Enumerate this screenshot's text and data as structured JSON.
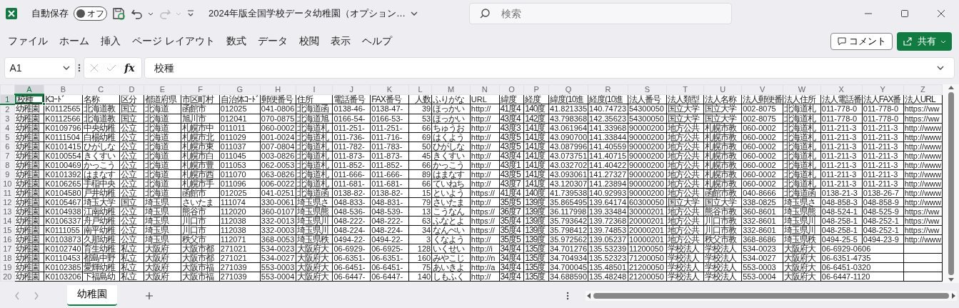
{
  "title_bar": {
    "autosave_label": "自動保存",
    "autosave": {
      "on": false,
      "label": "オフ"
    },
    "redo_disabled": true,
    "document_title": "2024年版全国学校データ幼稚園（オプション…",
    "search": {
      "placeholder": "検索"
    }
  },
  "menu": [
    "ファイル",
    "ホーム",
    "挿入",
    "ページ レイアウト",
    "数式",
    "データ",
    "校閲",
    "表示",
    "ヘルプ"
  ],
  "actions": [
    {
      "label": "コメント",
      "kind": "outline"
    },
    {
      "label": "共有",
      "kind": "primary"
    }
  ],
  "formula_bar": {
    "name_box": "A1",
    "function_label": "fx",
    "formula": "校種"
  },
  "sheet": {
    "columns": [
      {
        "letter": "A",
        "selected": true
      },
      {
        "letter": "B",
        "selected": false
      },
      {
        "letter": "C",
        "selected": false
      },
      {
        "letter": "D",
        "selected": false
      },
      {
        "letter": "E",
        "selected": false
      },
      {
        "letter": "F",
        "selected": false
      },
      {
        "letter": "G",
        "selected": false
      },
      {
        "letter": "H",
        "selected": false
      },
      {
        "letter": "I",
        "selected": false
      },
      {
        "letter": "J",
        "selected": false
      },
      {
        "letter": "K",
        "selected": false
      },
      {
        "letter": "L",
        "selected": false,
        "numeric": true
      },
      {
        "letter": "M",
        "selected": false
      },
      {
        "letter": "N",
        "selected": false
      },
      {
        "letter": "O",
        "selected": false
      },
      {
        "letter": "P",
        "selected": false
      },
      {
        "letter": "Q",
        "selected": false
      },
      {
        "letter": "R",
        "selected": false
      },
      {
        "letter": "S",
        "selected": false
      },
      {
        "letter": "T",
        "selected": false
      },
      {
        "letter": "U",
        "selected": false
      },
      {
        "letter": "V",
        "selected": false
      },
      {
        "letter": "W",
        "selected": false
      },
      {
        "letter": "X",
        "selected": false
      },
      {
        "letter": "Y",
        "selected": false
      },
      {
        "letter": "Z",
        "selected": false
      }
    ],
    "rows": [
      {
        "number": "1",
        "selected": true,
        "cells": [
          "校種",
          "Kｺｰﾄﾞ",
          "名称",
          "区分",
          "都道府県",
          "市区町村",
          "自治体ｺｰﾄﾞ",
          "郵便番号",
          "住所",
          "電話番号",
          "FAX番号",
          "人数",
          "ふりがな",
          "URL",
          "緯度",
          "経度",
          "緯度(10進",
          "経度(10進",
          "法人番号",
          "法人類型",
          "法人名称",
          "法人郵便番",
          "法人住所",
          "法人電話番",
          "法人FAX番",
          "法人URL"
        ]
      },
      {
        "number": "2",
        "selected": false,
        "cells": [
          "幼稚園",
          "K0112565",
          "北海道教",
          "国立",
          "北海道",
          "函館市",
          "012025",
          "041-0806",
          "北海道函",
          "0138-46-",
          "0138-47-",
          "39",
          "ほっかい",
          "http://",
          "41度4",
          "140度",
          "41.821335",
          "140.74723",
          "54300050",
          "国立大学",
          "国立大学",
          "002-8075",
          "北海道札",
          "011-778-0",
          "011-778-0",
          "https://ww"
        ]
      },
      {
        "number": "3",
        "selected": false,
        "cells": [
          "幼稚園",
          "K0112566",
          "北海道教",
          "国立",
          "北海道",
          "旭川市",
          "012041",
          "070-0875",
          "北海道旭",
          "0166-54-",
          "0166-53-",
          "53",
          "ほっかい",
          "http://",
          "43度4",
          "142度",
          "43.798368",
          "142.35623",
          "54300050",
          "国立大学",
          "国立大学",
          "002-8075",
          "北海道札",
          "011-778-0",
          "011-778-0",
          "https://ww"
        ]
      },
      {
        "number": "4",
        "selected": false,
        "cells": [
          "幼稚園",
          "K0109796",
          "中央幼稚",
          "公立",
          "北海道",
          "札幌市中",
          "011011",
          "060-0002",
          "北海道札",
          "011-251-",
          "011-251-",
          "66",
          "ちゅうお",
          "http://",
          "43度3",
          "141度",
          "43.061964",
          "141.33968",
          "90000200",
          "地方公共",
          "札幌市教",
          "060-0002",
          "北海道札",
          "011-211-3",
          "011-211-3",
          "http://www"
        ]
      },
      {
        "number": "5",
        "selected": false,
        "cells": [
          "幼稚園",
          "K0111504",
          "白楊幼稚",
          "公立",
          "北海道",
          "札幌市北",
          "011029",
          "001-0024",
          "北海道札",
          "011-736-",
          "011-716-",
          "69",
          "はくよう",
          "http://",
          "43度5",
          "141度",
          "43.090700",
          "141.33844",
          "90000200",
          "地方公共",
          "札幌市教",
          "060-0002",
          "北海道札",
          "011-211-3",
          "011-211-3",
          "http://www"
        ]
      },
      {
        "number": "6",
        "selected": false,
        "cells": [
          "幼稚園",
          "K0101415",
          "ひがしな",
          "公立",
          "北海道",
          "札幌市東",
          "011037",
          "007-0804",
          "北海道札",
          "011-782-",
          "011-783-",
          "50",
          "ひがしな",
          "http://",
          "43度5",
          "141度",
          "43.087996",
          "141.40559",
          "90000200",
          "地方公共",
          "札幌市教",
          "060-0002",
          "北海道札",
          "011-211-3",
          "011-211-3",
          "http://www"
        ]
      },
      {
        "number": "7",
        "selected": false,
        "cells": [
          "幼稚園",
          "K0100554",
          "きくすい",
          "公立",
          "北海道",
          "札幌市白",
          "011045",
          "003-0826",
          "北海道札",
          "011-873-",
          "011-873-",
          "45",
          "きくすい",
          "http://",
          "43度4",
          "141度",
          "43.073751",
          "141.40715",
          "90000200",
          "地方公共",
          "札幌市教",
          "060-0002",
          "北海道札",
          "011-211-3",
          "011-211-3",
          "http://www"
        ]
      },
      {
        "number": "8",
        "selected": false,
        "cells": [
          "幼稚園",
          "K0100469",
          "かっこう",
          "公立",
          "北海道",
          "札幌市豊",
          "011053",
          "062-0053",
          "北海道札",
          "011-852-",
          "011-852-",
          "66",
          "かっこう",
          "http://",
          "43度1",
          "141度",
          "43.032702",
          "141.40422",
          "90000200",
          "地方公共",
          "札幌市教",
          "060-0002",
          "北海道札",
          "011-211-3",
          "011-211-3",
          "http://www"
        ]
      },
      {
        "number": "9",
        "selected": false,
        "cells": [
          "幼稚園",
          "K0101392",
          "はまなす",
          "公立",
          "北海道",
          "札幌市西",
          "011070",
          "063-0826",
          "北海道札",
          "011-666-",
          "011-666-",
          "89",
          "はまなす",
          "http://",
          "43度5",
          "141度",
          "43.093061",
          "141.27327",
          "90000200",
          "地方公共",
          "札幌市教",
          "060-0002",
          "北海道札",
          "011-211-3",
          "011-211-3",
          "http://www"
        ]
      },
      {
        "number": "10",
        "selected": false,
        "cells": [
          "幼稚園",
          "K0106265",
          "手稲中央",
          "公立",
          "北海道",
          "札幌市手",
          "011096",
          "006-0022",
          "北海道札",
          "011-681-",
          "011-681-",
          "66",
          "ていねち",
          "http://",
          "43度7",
          "141度",
          "43.120307",
          "141.23894",
          "90000200",
          "地方公共",
          "札幌市教",
          "060-0002",
          "北海道札",
          "011-211-3",
          "011-211-3",
          "http://www"
        ]
      },
      {
        "number": "11",
        "selected": false,
        "cells": [
          "幼稚園",
          "K0104580",
          "戸井幼稚",
          "公立",
          "北海道",
          "函館市",
          "012025",
          "041-0251",
          "北海道函",
          "0138-82-",
          "0138-82-",
          "15",
          "といよう",
          "https://",
          "41度4",
          "140度",
          "41.739538",
          "140.92993",
          "90000200",
          "地方公共",
          "函館市教",
          "040-8666",
          "北海道函",
          "0138-21-3",
          "0138-26-7",
          "http://www"
        ]
      },
      {
        "number": "12",
        "selected": false,
        "cells": [
          "幼稚園",
          "K0105467",
          "埼玉大学",
          "国立",
          "埼玉県",
          "さいたま",
          "111074",
          "330-0061",
          "埼玉県さ",
          "048-833-",
          "048-831-",
          "79",
          "さいたま",
          "http://",
          "35度5",
          "139度",
          "35.865495",
          "139.64174",
          "60300050",
          "国立大学",
          "国立大学",
          "338-0825",
          "埼玉県さ",
          "048-858-3",
          "048-858-9",
          "http://www"
        ]
      },
      {
        "number": "13",
        "selected": false,
        "cells": [
          "幼稚園",
          "K0104938",
          "江南幼稚",
          "公立",
          "埼玉県",
          "熊谷市",
          "112020",
          "360-0107",
          "埼玉県熊",
          "048-536-",
          "048-539-",
          "13",
          "こうなん",
          "https://",
          "36度7",
          "139度",
          "36.117998",
          "139.33484",
          "30000201",
          "地方公共",
          "熊谷市教",
          "360-8601",
          "埼玉県熊",
          "048-524-1",
          "048-525-9",
          "https://ww"
        ]
      },
      {
        "number": "14",
        "selected": false,
        "cells": [
          "幼稚園",
          "K0106337",
          "舟戸幼稚",
          "公立",
          "埼玉県",
          "川口市",
          "112038",
          "332-0013",
          "埼玉県川",
          "048-222-",
          "048-222-",
          "63",
          "ふなとよ",
          "https://",
          "35度4",
          "139度",
          "35.793642",
          "139.72368",
          "20000201",
          "地方公共",
          "川口市教",
          "332-8601",
          "埼玉県川",
          "048-258-1",
          "048-252-1",
          "https://ww"
        ]
      },
      {
        "number": "15",
        "selected": false,
        "cells": [
          "幼稚園",
          "K0111055",
          "南平幼稚",
          "公立",
          "埼玉県",
          "川口市",
          "112038",
          "332-0003",
          "埼玉県川",
          "048-224-",
          "048-224-",
          "34",
          "なんぺい",
          "https://",
          "35度4",
          "139度",
          "35.798412",
          "139.74853",
          "20000201",
          "地方公共",
          "川口市教",
          "332-8601",
          "埼玉県川",
          "048-258-1",
          "048-252-1",
          "https://ww"
        ]
      },
      {
        "number": "16",
        "selected": false,
        "cells": [
          "幼稚園",
          "K0103873",
          "久那幼稚",
          "公立",
          "埼玉県",
          "秩父市",
          "112071",
          "368-0053",
          "埼玉県秩",
          "0494-22-",
          "0494-22-",
          "3",
          "くなよう",
          "http://",
          "35度5",
          "139度",
          "35.972562",
          "139.05237",
          "10000201",
          "地方公共",
          "秩父市教",
          "368-8686",
          "埼玉県秩",
          "0494-25-5",
          "0494-23-9",
          "http://www"
        ]
      },
      {
        "number": "17",
        "selected": false,
        "cells": [
          "幼稚園",
          "K0102740",
          "育生幼稚",
          "私立",
          "大阪府",
          "大阪市都",
          "271021",
          "534-0023",
          "大阪府大",
          "06-6929-",
          "06-6925-",
          "128",
          "いくせい",
          "http://i",
          "34度4",
          "135度",
          "34.701276",
          "135.53239",
          "11200050",
          "学校法人",
          "学校法人",
          "534-0023",
          "大阪府大",
          {
            "text": "06-6929-0606",
            "colspan": 2
          },
          null
        ]
      },
      {
        "number": "18",
        "selected": false,
        "cells": [
          "幼稚園",
          "K0110453",
          "都島中野",
          "私立",
          "大阪府",
          "大阪市都",
          "271021",
          "534-0027",
          "大阪府大",
          "06-6351-",
          "06-6351-",
          "160",
          "みやこじ",
          "http://n",
          "34度4",
          "135度",
          "34.704934",
          "135.52323",
          "71200050",
          "学校法人",
          "学校法人",
          "534-0027",
          "大阪府大",
          {
            "text": "06-6351-4735",
            "colspan": 2
          },
          null
        ]
      },
      {
        "number": "19",
        "selected": false,
        "cells": [
          "幼稚園",
          "K0102385",
          "愛輝幼稚",
          "私立",
          "大阪府",
          "大阪市福",
          "271039",
          "553-0003",
          "大阪府大",
          "06-6451-",
          "06-6451-",
          "75",
          "あいきよ",
          "http://a",
          "34度4",
          "135度",
          "34.700045",
          "135.48501",
          "21200050",
          "学校法人",
          "学校法人",
          "553-0003",
          "大阪府大",
          {
            "text": "06-6451-0320",
            "colspan": 2
          },
          null
        ]
      },
      {
        "number": "20",
        "selected": false,
        "cells": [
          "幼稚園",
          "K0103206",
          "下福島幼",
          "私立",
          "大阪府",
          "大阪市福",
          "271039",
          "553-0004",
          "大阪府大",
          "06-6447-",
          "06-6447-",
          "140",
          "しもふく",
          "http://",
          "34度4",
          "135度",
          "34.688590",
          "135.48248",
          "21200050",
          "学校法人",
          "学校法人",
          "553-0004",
          "大阪府大",
          {
            "text": "06-6447-1120",
            "colspan": 2
          },
          null
        ]
      }
    ]
  },
  "sheet_tabs": [
    {
      "label": "幼稚園",
      "selected": true
    }
  ]
}
